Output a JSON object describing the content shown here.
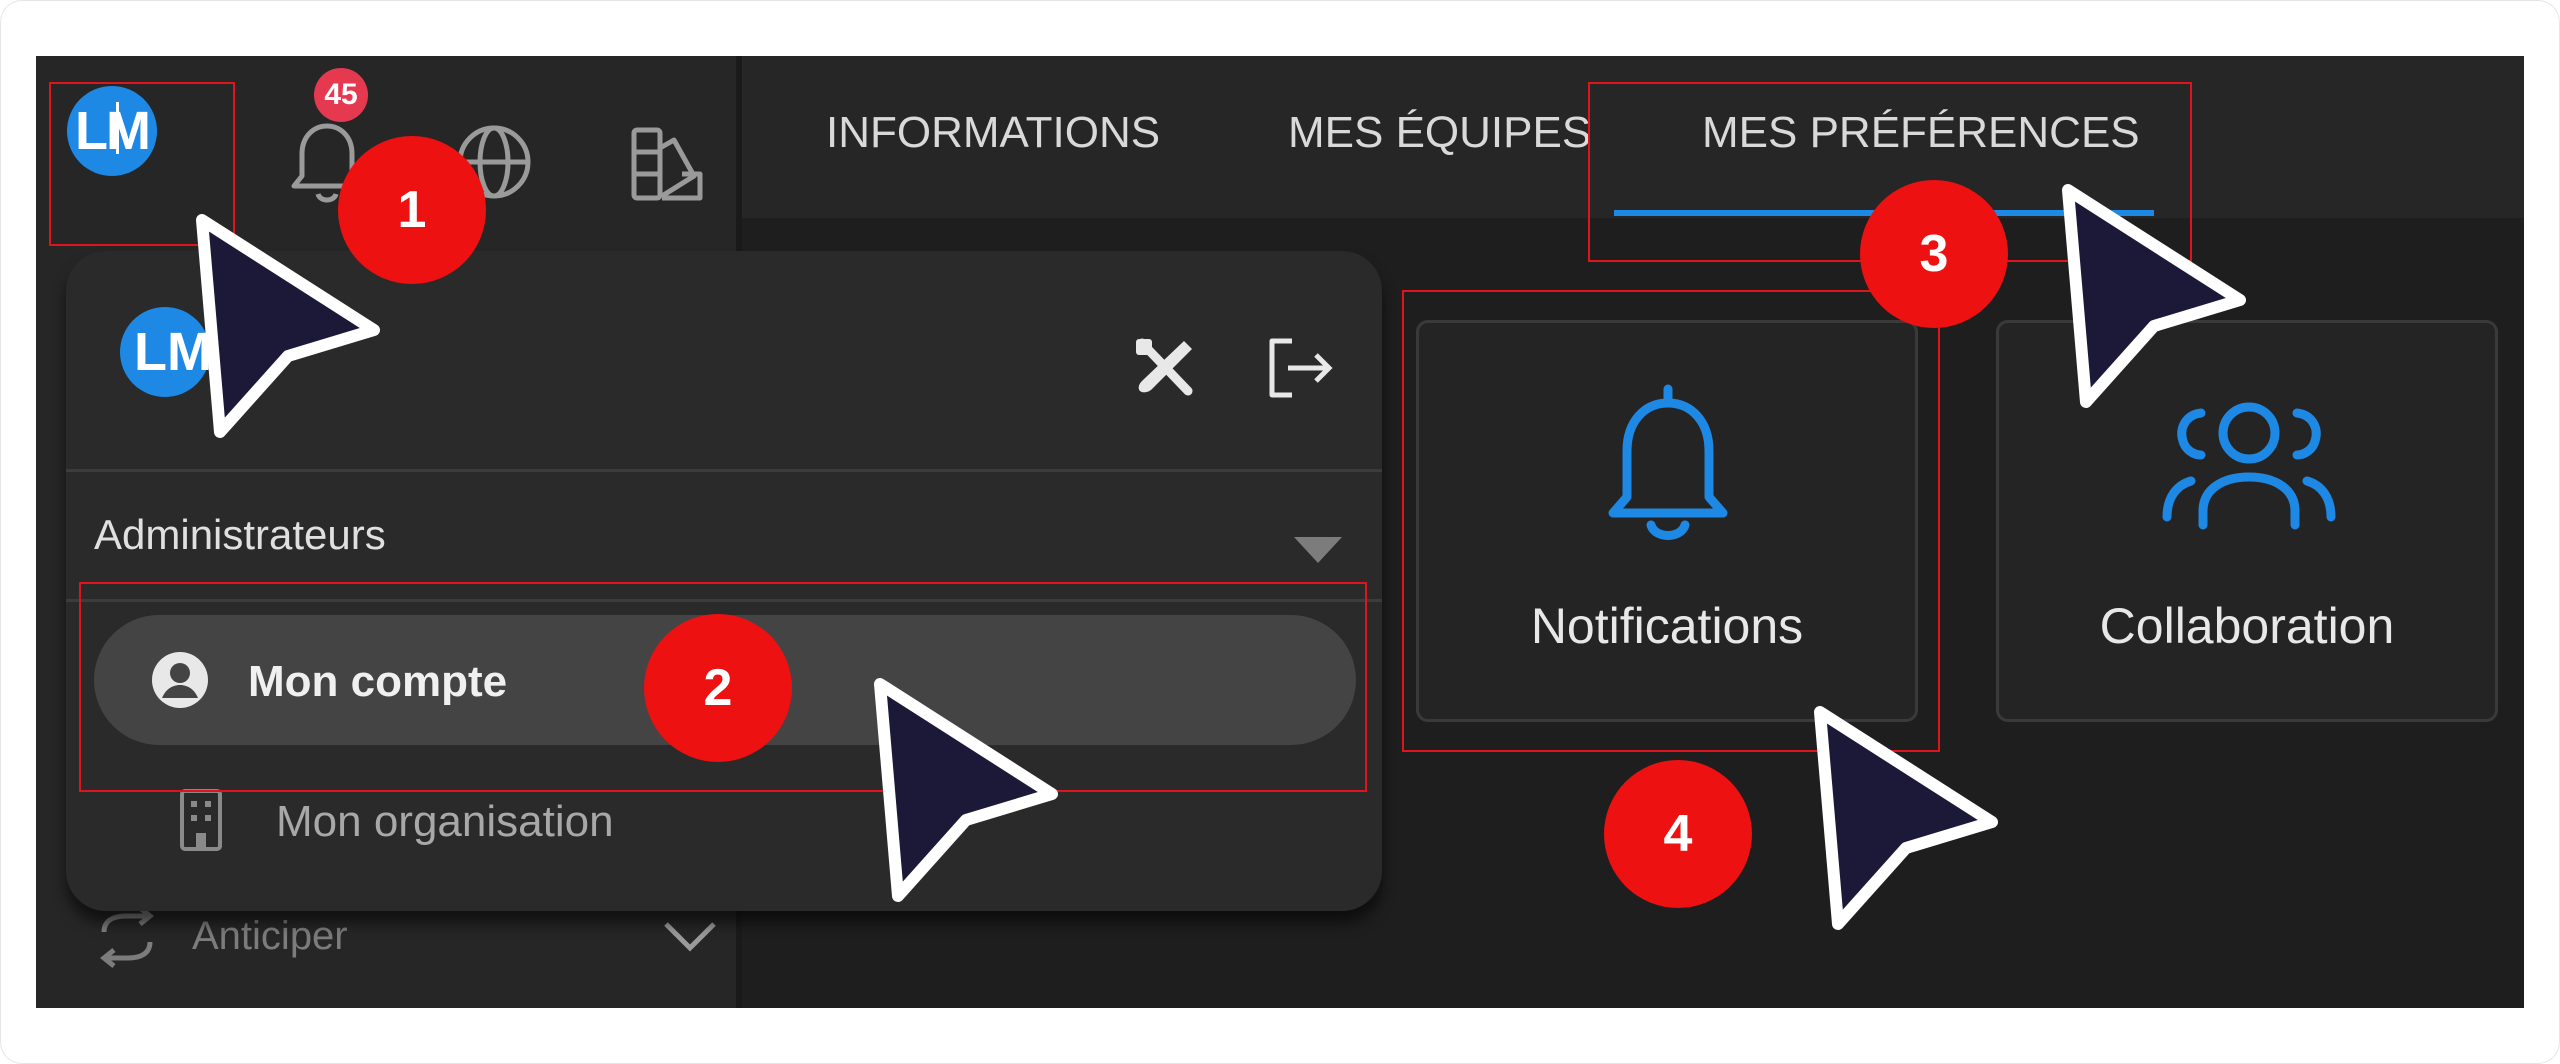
{
  "header": {
    "avatar_initials": "LM",
    "notification_count": "45",
    "icons": [
      "bell-icon",
      "globe-icon",
      "palette-icon"
    ]
  },
  "tabs": [
    {
      "label": "INFORMATIONS",
      "active": false
    },
    {
      "label": "MES ÉQUIPES",
      "active": false
    },
    {
      "label": "MES PRÉFÉRENCES",
      "active": true
    }
  ],
  "account_menu": {
    "avatar_initials": "LM",
    "icons": [
      "tools-icon",
      "logout-icon"
    ],
    "role_select": "Administrateurs",
    "items": [
      {
        "label": "Mon compte",
        "icon": "account-circle-icon",
        "active": true
      },
      {
        "label": "Mon organisation",
        "icon": "building-icon",
        "active": false
      }
    ]
  },
  "sidebar": {
    "items": [
      {
        "label": "Anticiper",
        "icon": "sync-icon",
        "expanded": false
      }
    ]
  },
  "preferences_cards": [
    {
      "label": "Notifications",
      "icon": "bell-icon"
    },
    {
      "label": "Collaboration",
      "icon": "people-group-icon"
    }
  ],
  "tutorial_steps": [
    "1",
    "2",
    "3",
    "4"
  ],
  "colors": {
    "accent": "#1e88e5",
    "badge": "#e53950",
    "step_marker": "#ee1111",
    "highlight_box": "#e0141c",
    "background": "#1e1e1e"
  }
}
